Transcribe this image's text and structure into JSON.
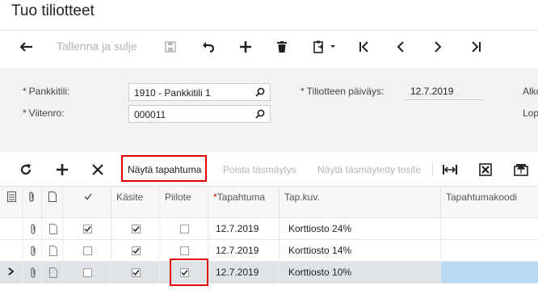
{
  "page": {
    "title": "Tuo tiliotteet"
  },
  "toolbar": {
    "save_close_label": "Tallenna ja sulje",
    "icons": [
      "back-arrow-icon",
      "save-icon",
      "undo-icon",
      "add-icon",
      "delete-icon",
      "paste-icon",
      "first-icon",
      "prev-icon",
      "next-icon",
      "last-icon"
    ]
  },
  "form": {
    "bank_account": {
      "label": "Pankkitili:",
      "value": "1910 - Pankkitili 1"
    },
    "reference": {
      "label": "Viitenro:",
      "value": "000011"
    },
    "statement_date": {
      "label": "Tiliotteen päiväys:",
      "value": "12.7.2019"
    },
    "right_label_1": "Alku",
    "right_label_2": "Lop"
  },
  "grid_toolbar": {
    "show_transaction": "Näytä tapahtuma",
    "remove_match": "Poista täsmäytys",
    "show_matched_doc": "Näytä täsmäytetty tosite"
  },
  "table": {
    "columns": {
      "handled": "Käsite",
      "hidden": "Piilote",
      "date": "Tapahtuma",
      "description": "Tap.kuv.",
      "code": "Tapahtumakoodi"
    },
    "rows": [
      {
        "check": true,
        "handled": true,
        "hidden": false,
        "date": "12.7.2019",
        "description": "Korttiosto 24%",
        "selected": false
      },
      {
        "check": false,
        "handled": true,
        "hidden": false,
        "date": "12.7.2019",
        "description": "Korttiosto 14%",
        "selected": false
      },
      {
        "check": false,
        "handled": true,
        "hidden": true,
        "date": "12.7.2019",
        "description": "Korttiosto 10%",
        "selected": true
      }
    ]
  },
  "colors": {
    "accent_red": "#e10000",
    "selected_row": "#dfe3e8",
    "selected_cell": "#b9d9f3"
  }
}
